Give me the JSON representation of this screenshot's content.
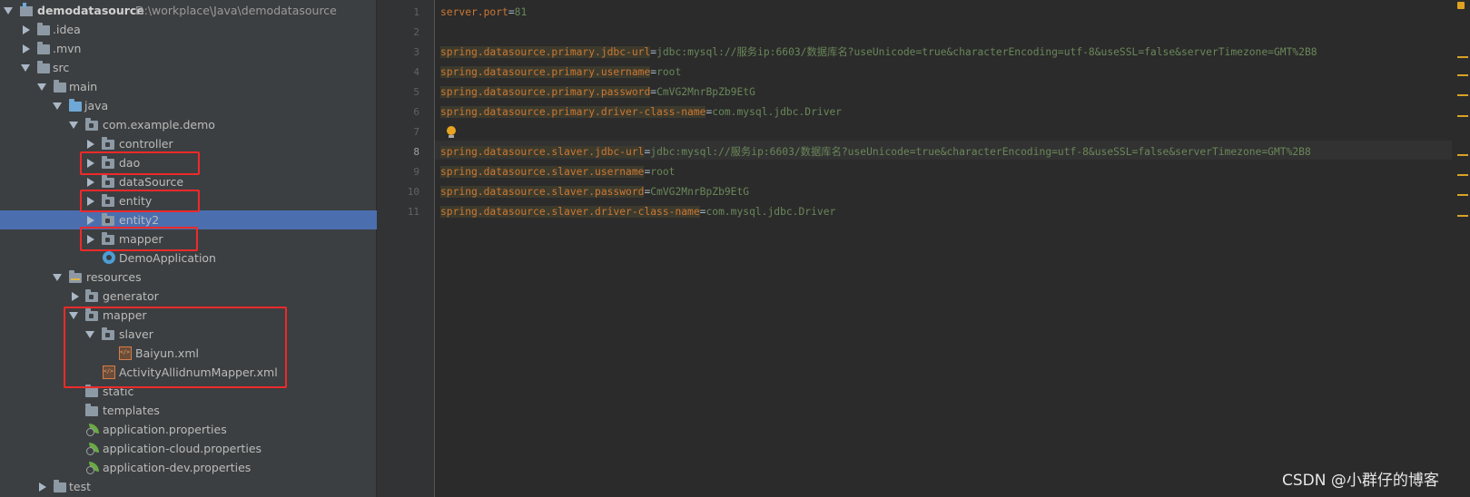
{
  "project_tree": {
    "root": {
      "name": "demodatasource",
      "path": "D:\\workplace\\Java\\demodatasource"
    },
    "items": [
      {
        "label": "demodatasource",
        "icon": "module-icon",
        "arrow": "open"
      },
      {
        "label": ".idea",
        "icon": "folder-icon",
        "arrow": "closed"
      },
      {
        "label": ".mvn",
        "icon": "folder-icon",
        "arrow": "closed"
      },
      {
        "label": "src",
        "icon": "folder-icon",
        "arrow": "open"
      },
      {
        "label": "main",
        "icon": "folder-icon",
        "arrow": "open"
      },
      {
        "label": "java",
        "icon": "source-folder-icon",
        "arrow": "open"
      },
      {
        "label": "com.example.demo",
        "icon": "package-icon",
        "arrow": "open"
      },
      {
        "label": "controller",
        "icon": "package-icon",
        "arrow": "closed"
      },
      {
        "label": "dao",
        "icon": "package-icon",
        "arrow": "closed"
      },
      {
        "label": "dataSource",
        "icon": "package-icon",
        "arrow": "closed"
      },
      {
        "label": "entity",
        "icon": "package-icon",
        "arrow": "closed"
      },
      {
        "label": "entity2",
        "icon": "package-icon",
        "arrow": "closed",
        "selected": true
      },
      {
        "label": "mapper",
        "icon": "package-icon",
        "arrow": "closed"
      },
      {
        "label": "DemoApplication",
        "icon": "spring-class-icon",
        "arrow": "none"
      },
      {
        "label": "resources",
        "icon": "resources-folder-icon",
        "arrow": "open"
      },
      {
        "label": "generator",
        "icon": "package-icon",
        "arrow": "closed"
      },
      {
        "label": "mapper",
        "icon": "package-icon",
        "arrow": "open"
      },
      {
        "label": "slaver",
        "icon": "package-icon",
        "arrow": "open"
      },
      {
        "label": "Baiyun.xml",
        "icon": "xml-file-icon",
        "arrow": "none"
      },
      {
        "label": "ActivityAllidnumMapper.xml",
        "icon": "xml-file-icon",
        "arrow": "none"
      },
      {
        "label": "static",
        "icon": "folder-icon",
        "arrow": "none"
      },
      {
        "label": "templates",
        "icon": "folder-icon",
        "arrow": "none"
      },
      {
        "label": "application.properties",
        "icon": "spring-properties-icon",
        "arrow": "none"
      },
      {
        "label": "application-cloud.properties",
        "icon": "spring-properties-icon",
        "arrow": "none"
      },
      {
        "label": "application-dev.properties",
        "icon": "spring-properties-icon",
        "arrow": "none"
      },
      {
        "label": "test",
        "icon": "folder-icon",
        "arrow": "closed"
      }
    ]
  },
  "editor": {
    "current_line": 8,
    "lines": [
      {
        "num": "1",
        "key": "server.port",
        "value": "81"
      },
      {
        "num": "2",
        "key": "",
        "value": ""
      },
      {
        "num": "3",
        "key": "spring.datasource.primary.jdbc-url",
        "value": "jdbc:mysql://服务ip:6603/数据库名?useUnicode=true&characterEncoding=utf-8&useSSL=false&serverTimezone=GMT%2B8"
      },
      {
        "num": "4",
        "key": "spring.datasource.primary.username",
        "value": "root"
      },
      {
        "num": "5",
        "key": "spring.datasource.primary.password",
        "value": "CmVG2MnrBpZb9EtG"
      },
      {
        "num": "6",
        "key": "spring.datasource.primary.driver-class-name",
        "value": "com.mysql.jdbc.Driver"
      },
      {
        "num": "7",
        "key": "",
        "value": ""
      },
      {
        "num": "8",
        "key": "spring.datasource.slaver.jdbc-url",
        "value": "jdbc:mysql://服务ip:6603/数据库名?useUnicode=true&characterEncoding=utf-8&useSSL=false&serverTimezone=GMT%2B8"
      },
      {
        "num": "9",
        "key": "spring.datasource.slaver.username",
        "value": "root"
      },
      {
        "num": "10",
        "key": "spring.datasource.slaver.password",
        "value": "CmVG2MnrBpZb9EtG"
      },
      {
        "num": "11",
        "key": "spring.datasource.slaver.driver-class-name",
        "value": "com.mysql.jdbc.Driver"
      }
    ]
  },
  "watermark": "CSDN @小群仔的博客",
  "colors": {
    "tree_bg": "#3c3f41",
    "editor_bg": "#2b2b2b",
    "selection": "#4b6eaf",
    "property_key": "#cc7832",
    "property_value": "#6a8759",
    "highlight_box": "#ee2a2a"
  }
}
